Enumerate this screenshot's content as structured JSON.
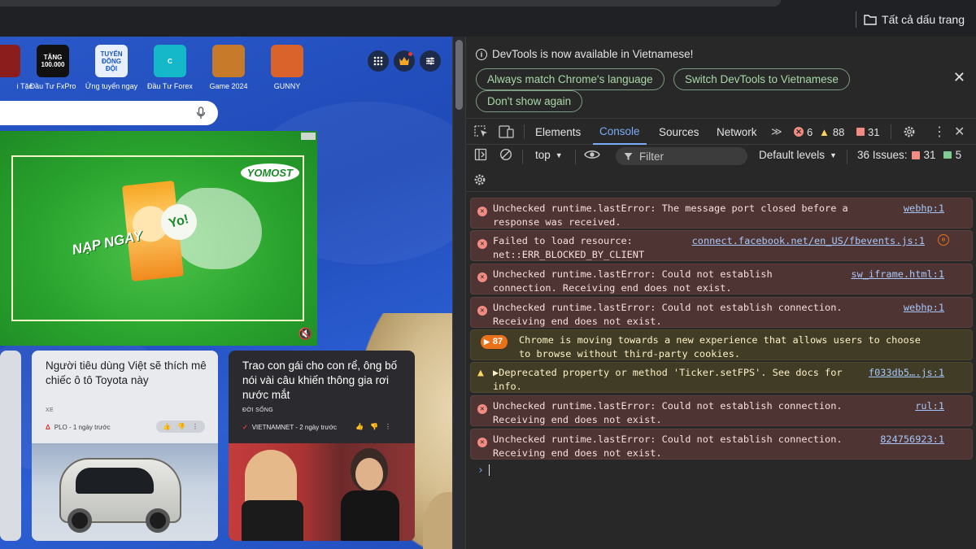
{
  "browser": {
    "bookmarks_label": "Tất cả dấu trang"
  },
  "page": {
    "apps": [
      {
        "label": "i Tặc",
        "icon_text": "",
        "color": "#8b1d1d"
      },
      {
        "label": "Đầu Tư FxPro",
        "icon_text": "TẶNG 100.000",
        "color": "#111111"
      },
      {
        "label": "Ứng tuyển ngay",
        "icon_text": "TUYỂN ĐỒNG ĐỘI",
        "color": "#e8f0ff"
      },
      {
        "label": "Đầu Tư Forex",
        "icon_text": "C",
        "color": "#14b8c8"
      },
      {
        "label": "Game 2024",
        "icon_text": "",
        "color": "#c77b2a"
      },
      {
        "label": "GUNNY",
        "icon_text": "",
        "color": "#d9632a"
      }
    ],
    "ad": {
      "brand": "YOMOST",
      "headline": "NẠP NGAY",
      "yo": "Yo!"
    },
    "cards": [
      {
        "title": "Người tiêu dùng Việt sẽ thích mê chiếc ô tô Toyota này",
        "category": "XE",
        "source": "PLO - 1 ngày trước"
      },
      {
        "title": "Trao con gái cho con rể, ông bố nói vài câu khiến thông gia rơi nước mắt",
        "category": "ĐỜI SỐNG",
        "source": "VIETNAMNET - 2 ngày trước"
      }
    ]
  },
  "devtools": {
    "notice": "DevTools is now available in Vietnamese!",
    "btn_match": "Always match Chrome's language",
    "btn_switch": "Switch DevTools to Vietnamese",
    "btn_dont_show": "Don't show again",
    "tabs": {
      "elements": "Elements",
      "console": "Console",
      "sources": "Sources",
      "network": "Network"
    },
    "counts": {
      "errors": "6",
      "warnings": "88",
      "issues": "31"
    },
    "toolbar": {
      "context": "top",
      "filter": "Filter",
      "levels": "Default levels",
      "issues_label": "36 Issues:",
      "issues_err": "31",
      "issues_msg": "5"
    },
    "messages": [
      {
        "level": "error",
        "text": "Unchecked runtime.lastError: The message port closed before a\nresponse was received.",
        "link": "webhp:1"
      },
      {
        "level": "error",
        "text": "Failed to load resource:\nnet::ERR_BLOCKED_BY_CLIENT",
        "link": "connect.facebook.net/en_US/fbevents.js:1"
      },
      {
        "level": "error",
        "text": "Unchecked runtime.lastError: Could not establish\nconnection. Receiving end does not exist.",
        "link": "sw_iframe.html:1"
      },
      {
        "level": "error",
        "text": "Unchecked runtime.lastError: Could not establish connection.\nReceiving end does not exist.",
        "link": "webhp:1"
      },
      {
        "level": "warning-group",
        "badge": "87",
        "text": "Chrome is moving towards a new experience that allows users to choose\nto browse without third-party cookies.",
        "link": ""
      },
      {
        "level": "warning",
        "text": "▶Deprecated property or method 'Ticker.setFPS'. See docs for\ninfo.",
        "link": "f033db5….js:1"
      },
      {
        "level": "error",
        "text": "Unchecked runtime.lastError: Could not establish connection.\nReceiving end does not exist.",
        "link": "rul:1"
      },
      {
        "level": "error",
        "text": "Unchecked runtime.lastError: Could not establish connection.\nReceiving end does not exist.",
        "link": "824756923:1"
      }
    ]
  }
}
